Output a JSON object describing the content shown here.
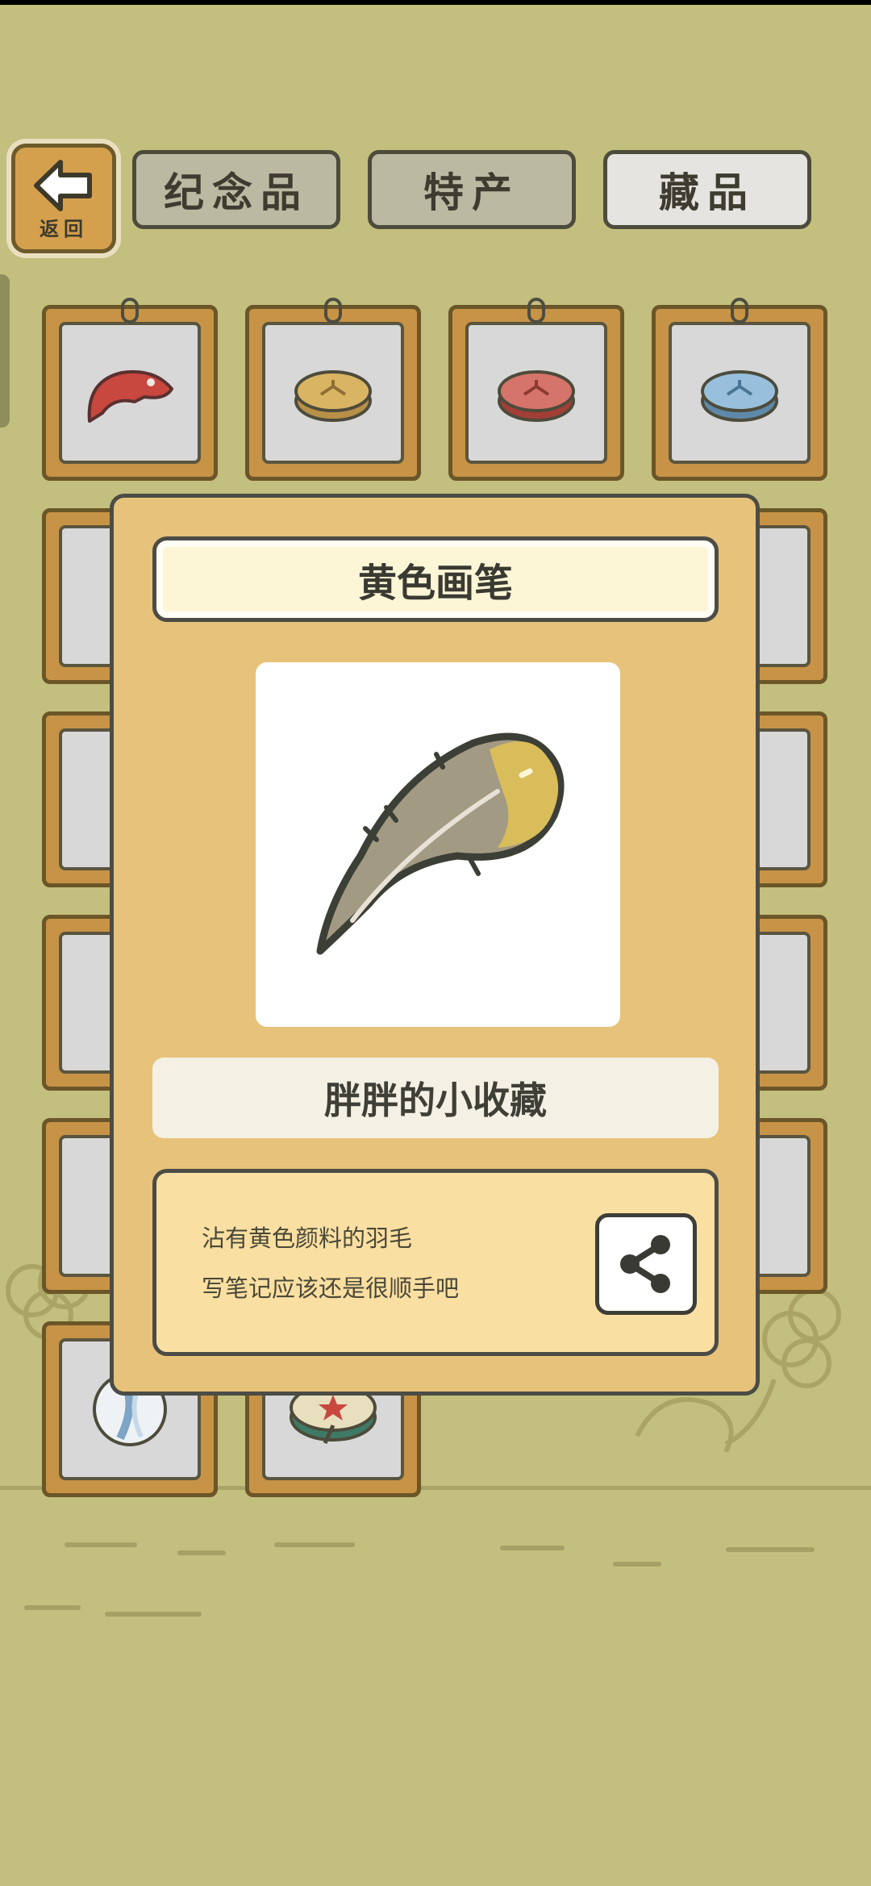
{
  "header": {
    "back_label": "返回",
    "tabs": [
      {
        "label": "纪念品",
        "active": false
      },
      {
        "label": "特产",
        "active": false
      },
      {
        "label": "藏品",
        "active": true
      }
    ]
  },
  "grid": {
    "items": [
      {
        "icon": "red-fish-icon"
      },
      {
        "icon": "yellow-token-icon"
      },
      {
        "icon": "red-token-icon"
      },
      {
        "icon": "blue-token-icon"
      },
      {
        "icon": "marble-icon"
      },
      {
        "icon": "flower-clover-icon"
      }
    ]
  },
  "modal": {
    "title": "黄色画笔",
    "item_icon": "yellow-feather-icon",
    "subtitle": "胖胖的小收藏",
    "description": [
      "沾有黄色颜料的羽毛",
      "写笔记应该还是很顺手吧"
    ],
    "share_icon": "share-icon"
  },
  "colors": {
    "background": "#c3bf7e",
    "modal": "#e7c27a",
    "slot_frame": "#c79346"
  }
}
